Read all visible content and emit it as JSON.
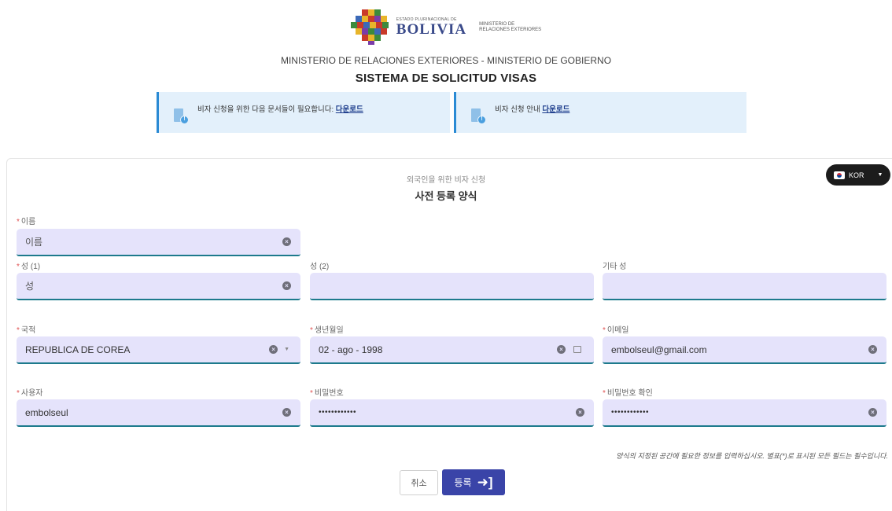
{
  "header": {
    "logo_small": "ESTADO PLURINACIONAL DE",
    "logo_big": "BOLIVIA",
    "logo_ministry_1": "MINISTERIO DE",
    "logo_ministry_2": "RELACIONES EXTERIORES",
    "subtitle": "MINISTERIO DE RELACIONES EXTERIORES - MINISTERIO DE GOBIERNO",
    "title": "SISTEMA DE SOLICITUD VISAS"
  },
  "info_boxes": [
    {
      "text": "비자 신청을 위한 다음 문서들이 필요합니다: ",
      "link": "다운로드"
    },
    {
      "text": "비자 신청 안내 ",
      "link": "다운로드"
    }
  ],
  "form": {
    "subtitle": "외국인을 위한 비자 신청",
    "title": "사전 등록 양식",
    "language": "KOR",
    "required_mark": "*",
    "fields": {
      "first_name": {
        "label": "이름",
        "value": "이름"
      },
      "surname1": {
        "label": "성 (1)",
        "value": "성"
      },
      "surname2": {
        "label": "성 (2)",
        "value": ""
      },
      "other_surname": {
        "label": "기타 성",
        "value": ""
      },
      "nationality": {
        "label": "국적",
        "value": "REPUBLICA DE COREA"
      },
      "birthdate": {
        "label": "생년월일",
        "value": "02 - ago - 1998"
      },
      "email": {
        "label": "이메일",
        "value": "embolseul@gmail.com"
      },
      "username": {
        "label": "사용자",
        "value": "embolseul"
      },
      "password": {
        "label": "비밀번호",
        "value": "••••••••••••"
      },
      "password_confirm": {
        "label": "비밀번호 확인",
        "value": "••••••••••••"
      }
    },
    "note": "양식의 지정된 공간에 필요한 정보를 입력하십시오. 별표(*)로 표시된 모든 필드는 필수입니다.",
    "cancel_label": "취소",
    "submit_label": "등록"
  },
  "icons": {
    "clear": "clear-icon",
    "dropdown": "chevron-down-icon",
    "calendar": "calendar-icon",
    "document_info": "document-info-icon",
    "login": "enter-icon",
    "flag": "korea-flag-icon"
  },
  "colors": {
    "field_bg": "#e5e3fb",
    "field_border": "#1d7a8c",
    "primary_button": "#3a44a8",
    "info_bg": "#e3f0fb",
    "info_border": "#2a8ad4",
    "required": "#e05555"
  }
}
